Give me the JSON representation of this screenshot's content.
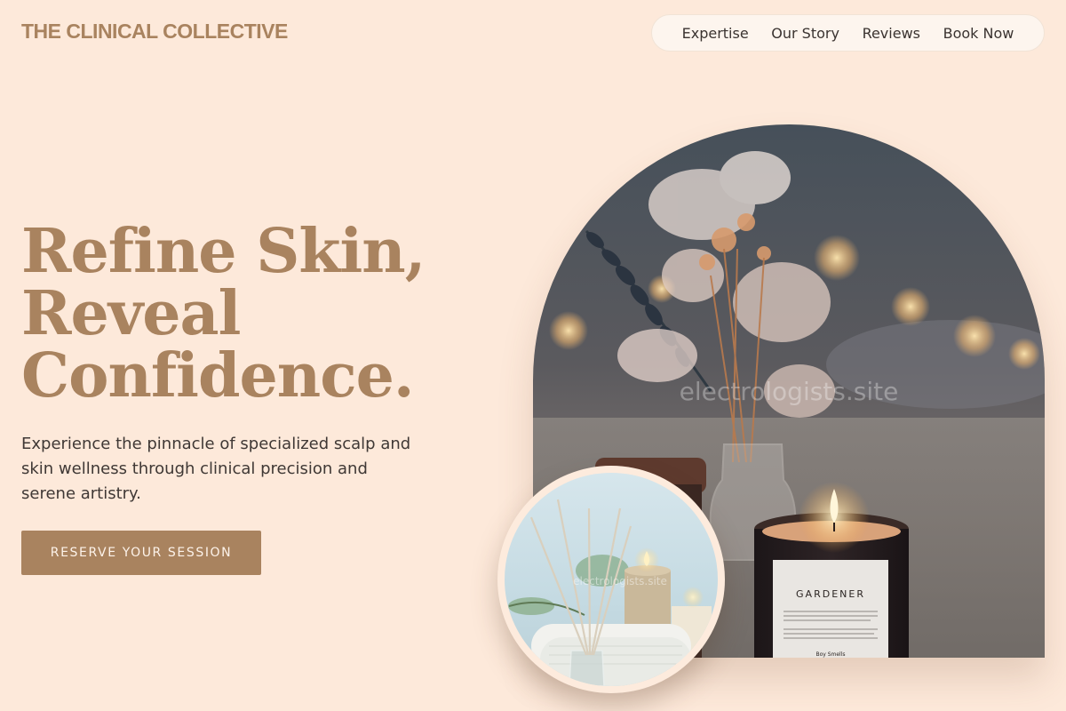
{
  "header": {
    "logo": "THE CLINICAL COLLECTIVE",
    "nav": [
      "Expertise",
      "Our Story",
      "Reviews",
      "Book Now"
    ]
  },
  "hero": {
    "headline_lines": [
      "Refine Skin,",
      "Reveal",
      "Confidence."
    ],
    "subtext": "Experience the pinnacle of specialized scalp and skin wellness through clinical precision and serene artistry.",
    "cta_label": "RESERVE YOUR SESSION"
  },
  "images": {
    "main_watermark": "electrologists.site",
    "candle_label": "GARDENER",
    "candle_brand": "Boy Smells",
    "small_watermark": "electrologists.site"
  },
  "colors": {
    "background": "#fde9da",
    "accent": "#a9835f",
    "nav_bg": "#fdf5ee"
  }
}
